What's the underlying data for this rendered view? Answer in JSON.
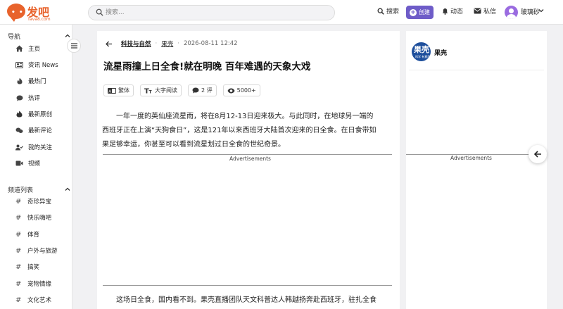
{
  "header": {
    "logo_text": "发吧",
    "logo_sub": "fava8.com",
    "search_placeholder": "搜索...",
    "nav": [
      {
        "label": "搜索",
        "icon": "search-icon"
      },
      {
        "label": "创建",
        "icon": "plus-circle-icon"
      },
      {
        "label": "动态",
        "icon": "bell-icon"
      },
      {
        "label": "私信",
        "icon": "envelope-icon"
      }
    ],
    "user_name": "玻璃砂",
    "accent_color": "#6e5cc8",
    "brand_color": "#e8632c"
  },
  "sidebar": {
    "nav_title": "导航",
    "nav_items": [
      {
        "label": "主页",
        "icon": "home-icon"
      },
      {
        "label": "资讯 News",
        "icon": "newspaper-icon"
      },
      {
        "label": "最热门",
        "icon": "flame-icon"
      },
      {
        "label": "热评",
        "icon": "comment-icon"
      },
      {
        "label": "最新原创",
        "icon": "fire-icon"
      },
      {
        "label": "最新评论",
        "icon": "comments-icon"
      },
      {
        "label": "我的关注",
        "icon": "user-check-icon"
      },
      {
        "label": "视频",
        "icon": "video-icon"
      }
    ],
    "channel_title": "频道列表",
    "channels": [
      "奇珍异宝",
      "快乐嗨吧",
      "体育",
      "户外与旅游",
      "搞笑",
      "宠物情缘",
      "文化艺术"
    ]
  },
  "article": {
    "category": "科技与自然",
    "source": "果壳",
    "date": "2026-08-11 12:42",
    "title": "流星雨撞上日全食!就在明晚 百年难遇的天象大戏",
    "tools": {
      "traditional": "繁体",
      "large_font": "大字阅读",
      "comments": "2 评",
      "views": "5000+"
    },
    "para1_lines": [
      "一年一度的英仙座流星雨，将在8月12-13日迎来极大。与此同时，在地球另一端的",
      "西班牙正在上演“天狗食日”，这是121年以来西班牙大陆首次迎来的日全食。在日食带如",
      "果足够幸运，你甚至可以看到流星划过日全食的世纪奇景。"
    ],
    "ad_label": "Advertisements",
    "para2_line": "这场日全食，国内看不到。果壳直播团队天文科普达人韩越扬奔赴西班牙，驻扎全食"
  },
  "right_panel": {
    "source_name": "果壳",
    "logo_text": "果壳",
    "logo_sub": "科学 有意思",
    "ad_label": "Advertisements"
  }
}
